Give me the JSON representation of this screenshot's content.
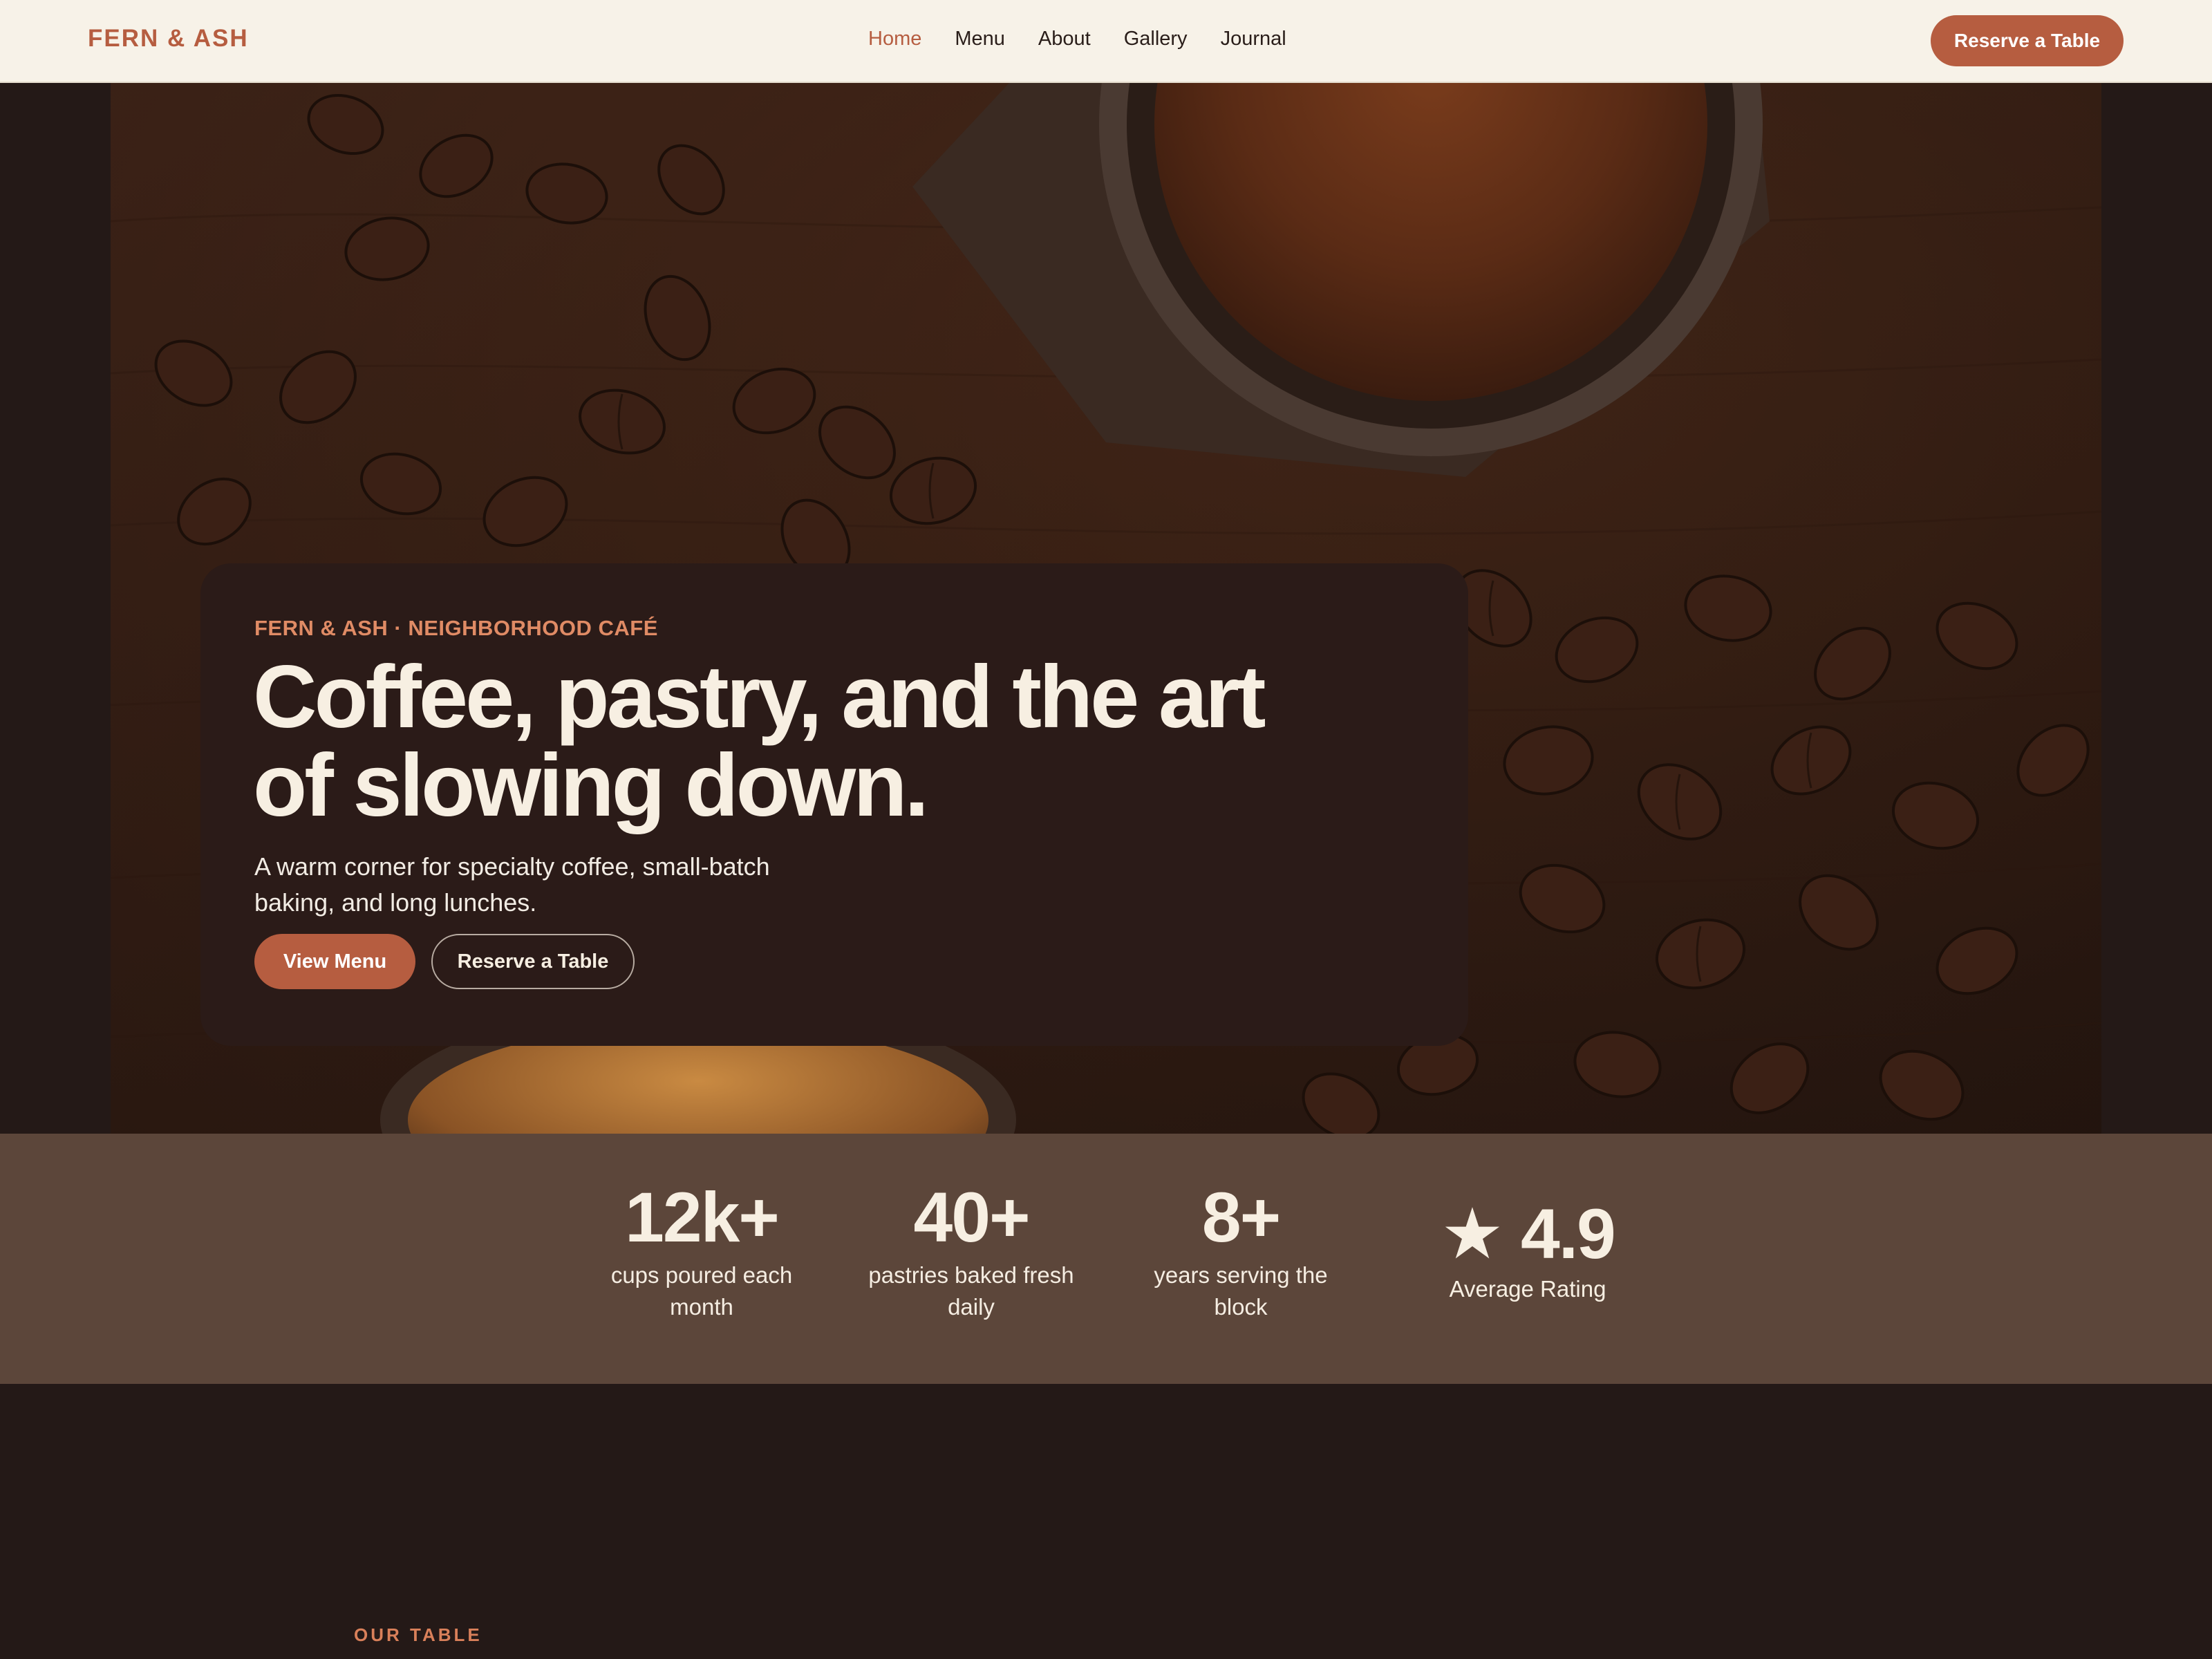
{
  "header": {
    "logo": "FERN & ASH",
    "nav": [
      "Home",
      "Menu",
      "About",
      "Gallery",
      "Journal"
    ],
    "active_nav": "Home",
    "cta_label": "Reserve a Table"
  },
  "hero": {
    "eyebrow": "FERN & ASH · NEIGHBORHOOD CAFÉ",
    "headline": "Coffee, pastry, and the art of slowing down.",
    "subhead": "A warm corner for specialty coffee, small-batch baking, and long lunches.",
    "primary_button": "View Menu",
    "secondary_button": "Reserve a Table"
  },
  "stats": [
    {
      "value": "12k+",
      "label": "cups poured each month"
    },
    {
      "value": "40+",
      "label": "pastries baked fresh daily"
    },
    {
      "value": "8+",
      "label": "years serving the block"
    }
  ],
  "rating": {
    "value": "★ 4.9",
    "label": "Average Rating"
  },
  "next_section": {
    "eyebrow": "OUR TABLE"
  },
  "colors": {
    "accent": "#b65d40",
    "header_bg": "#f7f2e8",
    "hero_card": "#2b1b18",
    "stats_bg": "#5c463a",
    "page_bg": "#241917",
    "cream_text": "#f7efe2"
  }
}
